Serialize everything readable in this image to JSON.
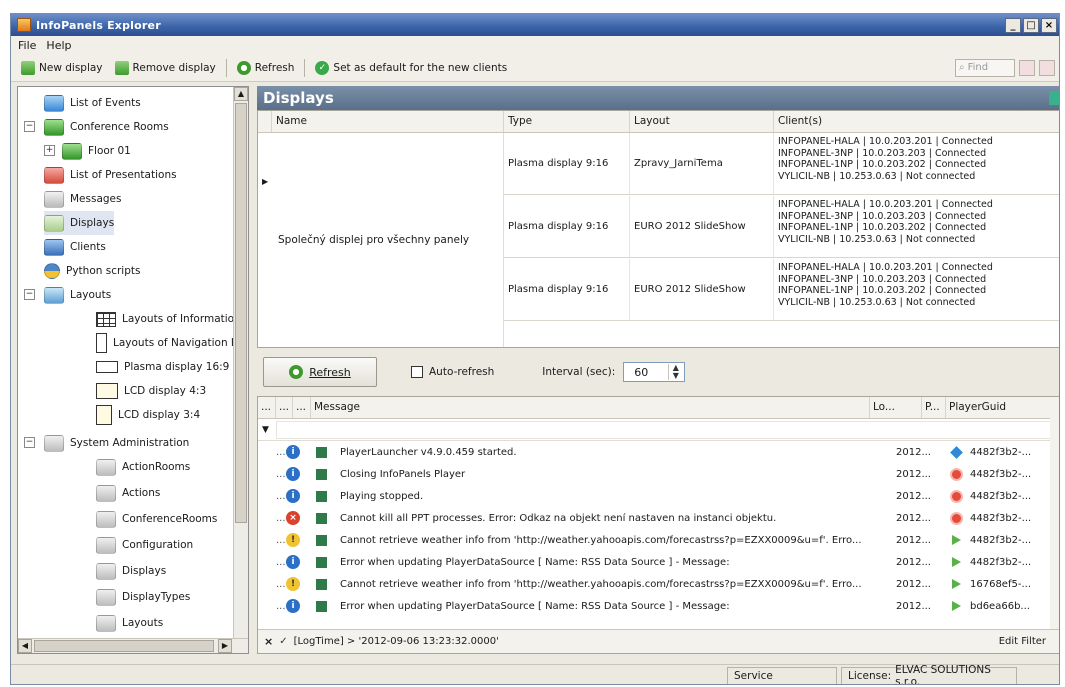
{
  "window": {
    "title": "InfoPanels Explorer",
    "min": "_",
    "max": "□",
    "close": "×"
  },
  "menu": {
    "file": "File",
    "help": "Help"
  },
  "toolbar": {
    "new_display": "New display",
    "remove_display": "Remove display",
    "refresh": "Refresh",
    "set_default": "Set as default for the new clients",
    "find": "Find"
  },
  "tree": {
    "items": [
      {
        "label": "List of Events",
        "icon": "events-icon"
      },
      {
        "label": "Conference Rooms",
        "icon": "rooms-icon",
        "expander": "−"
      },
      {
        "label": "Floor 01",
        "icon": "rooms-icon",
        "expander": "+"
      },
      {
        "label": "List of Presentations",
        "icon": "presentations-icon"
      },
      {
        "label": "Messages",
        "icon": "messages-icon"
      },
      {
        "label": "Displays",
        "icon": "displays-icon",
        "selected": true
      },
      {
        "label": "Clients",
        "icon": "clients-icon"
      },
      {
        "label": "Python scripts",
        "icon": "python-icon"
      },
      {
        "label": "Layouts",
        "icon": "layouts-icon",
        "expander": "−"
      },
      {
        "label": "Layouts of Information",
        "icon": "table-icon"
      },
      {
        "label": "Layouts of Navigation I",
        "icon": "portrait-icon"
      },
      {
        "label": "Plasma display 16:9",
        "icon": "landscape-icon"
      },
      {
        "label": "LCD display 4:3",
        "icon": "lcd43-icon"
      },
      {
        "label": "LCD display 3:4",
        "icon": "lcd34-icon"
      },
      {
        "label": "System Administration",
        "icon": "folder-icon",
        "expander": "−"
      },
      {
        "label": "ActionRooms",
        "icon": "folder-icon"
      },
      {
        "label": "Actions",
        "icon": "folder-icon"
      },
      {
        "label": "ConferenceRooms",
        "icon": "folder-icon"
      },
      {
        "label": "Configuration",
        "icon": "folder-icon"
      },
      {
        "label": "Displays",
        "icon": "folder-icon"
      },
      {
        "label": "DisplayTypes",
        "icon": "folder-icon"
      },
      {
        "label": "Layouts",
        "icon": "folder-icon"
      }
    ]
  },
  "panel": {
    "title": "Displays",
    "columns": {
      "name": "Name",
      "type": "Type",
      "layout": "Layout",
      "clients": "Client(s)"
    },
    "group_name": "Společný displej pro všechny panely",
    "rows": [
      {
        "type": "Plasma display 9:16",
        "layout": "Zpravy_JarniTema",
        "clients": [
          "INFOPANEL-HALA | 10.0.203.201 | Connected",
          "INFOPANEL-3NP | 10.0.203.203 | Connected",
          "INFOPANEL-1NP | 10.0.203.202 | Connected",
          "VYLICIL-NB | 10.253.0.63 | Not connected"
        ]
      },
      {
        "type": "Plasma display 9:16",
        "layout": "EURO 2012 SlideShow",
        "clients": [
          "INFOPANEL-HALA | 10.0.203.201 | Connected",
          "INFOPANEL-3NP | 10.0.203.203 | Connected",
          "INFOPANEL-1NP | 10.0.203.202 | Connected",
          "VYLICIL-NB | 10.253.0.63 | Not connected"
        ]
      },
      {
        "type": "Plasma display 9:16",
        "layout": "EURO 2012 SlideShow",
        "clients": [
          "INFOPANEL-HALA | 10.0.203.201 | Connected",
          "INFOPANEL-3NP | 10.0.203.203 | Connected",
          "INFOPANEL-1NP | 10.0.203.202 | Connected",
          "VYLICIL-NB | 10.253.0.63 | Not connected"
        ]
      }
    ]
  },
  "log": {
    "refresh_label": "Refresh",
    "auto_refresh_label": "Auto-refresh",
    "interval_label": "Interval (sec):",
    "interval_value": "60",
    "columns": {
      "a": "...",
      "b": "...",
      "c": "...",
      "message": "Message",
      "lo": "Lo...",
      "p": "P...",
      "guid": "PlayerGuid"
    },
    "rows": [
      {
        "dots": "...",
        "severity": "info",
        "message": "PlayerLauncher v4.9.0.459 started.",
        "lo": "2012...",
        "p": "diamond",
        "guid": "4482f3b2-..."
      },
      {
        "dots": "...",
        "severity": "info",
        "message": "Closing InfoPanels Player",
        "lo": "2012...",
        "p": "stop",
        "guid": "4482f3b2-..."
      },
      {
        "dots": "...",
        "severity": "info",
        "message": "Playing stopped.",
        "lo": "2012...",
        "p": "stop",
        "guid": "4482f3b2-..."
      },
      {
        "dots": "...",
        "severity": "error",
        "message": "Cannot kill all PPT processes. Error: Odkaz na objekt není nastaven na instanci objektu.",
        "lo": "2012...",
        "p": "stop",
        "guid": "4482f3b2-..."
      },
      {
        "dots": "...",
        "severity": "warn",
        "message": "Cannot retrieve weather info from 'http://weather.yahooapis.com/forecastrss?p=EZXX0009&u=f'. Erro...",
        "lo": "2012...",
        "p": "play",
        "guid": "4482f3b2-..."
      },
      {
        "dots": "...",
        "severity": "info",
        "message": "Error when updating PlayerDataSource [ Name: RSS Data Source ] - Message:",
        "lo": "2012...",
        "p": "play",
        "guid": "4482f3b2-..."
      },
      {
        "dots": "...",
        "severity": "warn",
        "message": "Cannot retrieve weather info from 'http://weather.yahooapis.com/forecastrss?p=EZXX0009&u=f'. Erro...",
        "lo": "2012...",
        "p": "play",
        "guid": "16768ef5-..."
      },
      {
        "dots": "...",
        "severity": "info",
        "message": "Error when updating PlayerDataSource [ Name: RSS Data Source ] - Message:",
        "lo": "2012...",
        "p": "play",
        "guid": "bd6ea66b..."
      }
    ],
    "filter_expression": "[LogTime] > '2012-09-06 13:23:32.0000'",
    "edit_filter": "Edit Filter"
  },
  "status": {
    "service": "Service",
    "license_label": "License:",
    "license_value": "ELVAC SOLUTIONS s.r.o."
  }
}
